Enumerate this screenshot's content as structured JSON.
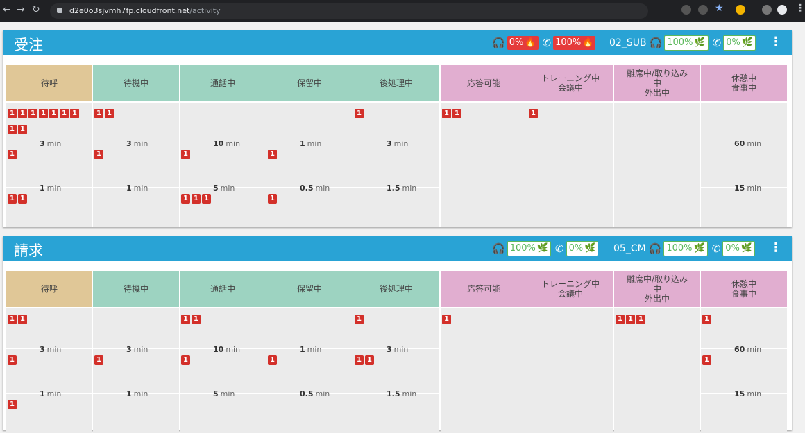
{
  "browser": {
    "url_host": "d2e0o3sjvmh7fp.cloudfront.net",
    "url_path": "/activity"
  },
  "columns": [
    "待呼",
    "待機中",
    "通話中",
    "保留中",
    "後処理中",
    "応答可能",
    "トレーニング中\n会議中",
    "離席中/取り込み\n中\n外出中",
    "休憩中\n食事中"
  ],
  "colors": {
    "header_bar": "#29a3d5",
    "col_waiting": "#e0c797",
    "col_agent": "#9dd3c1",
    "col_status": "#e1aed0",
    "badge": "#d3302a",
    "alert": "#e53b3b",
    "ok": "#5cb85c"
  },
  "panels": [
    {
      "title": "受注",
      "stats": {
        "s1_value": "0%",
        "s1_style": "red",
        "s2_value": "100%",
        "s2_style": "red",
        "queue": "02_SUB",
        "s3_value": "100%",
        "s3_style": "white",
        "s4_value": "0%",
        "s4_style": "white"
      },
      "thresholds": [
        [
          "3",
          "3",
          "10",
          "1",
          "3",
          "",
          "",
          "",
          "60"
        ],
        [
          "1",
          "1",
          "5",
          "0.5",
          "1.5",
          "",
          "",
          "",
          "15"
        ]
      ],
      "badges": [
        [
          9,
          2,
          0,
          0,
          1,
          2,
          1,
          0,
          0
        ],
        [
          1,
          1,
          1,
          1,
          0,
          0,
          0,
          0,
          0
        ],
        [
          2,
          0,
          3,
          1,
          0,
          0,
          0,
          0,
          0
        ]
      ]
    },
    {
      "title": "請求",
      "stats": {
        "s1_value": "100%",
        "s1_style": "white",
        "s2_value": "0%",
        "s2_style": "white",
        "queue": "05_CM",
        "s3_value": "100%",
        "s3_style": "white",
        "s4_value": "0%",
        "s4_style": "white"
      },
      "thresholds": [
        [
          "3",
          "3",
          "10",
          "1",
          "3",
          "",
          "",
          "",
          "60"
        ],
        [
          "1",
          "1",
          "5",
          "0.5",
          "1.5",
          "",
          "",
          "",
          "15"
        ]
      ],
      "badges": [
        [
          2,
          0,
          2,
          0,
          1,
          1,
          0,
          3,
          1
        ],
        [
          1,
          1,
          1,
          1,
          2,
          0,
          0,
          0,
          1
        ],
        [
          1,
          0,
          0,
          0,
          0,
          0,
          0,
          0,
          0
        ]
      ]
    }
  ],
  "labels": {
    "unit": "min",
    "badge": "1"
  },
  "icons": {
    "headset": "headset-icon",
    "phone": "phone-icon",
    "fire": "fire-icon",
    "leaf": "leaf-icon",
    "menu": "more-vert-icon"
  }
}
